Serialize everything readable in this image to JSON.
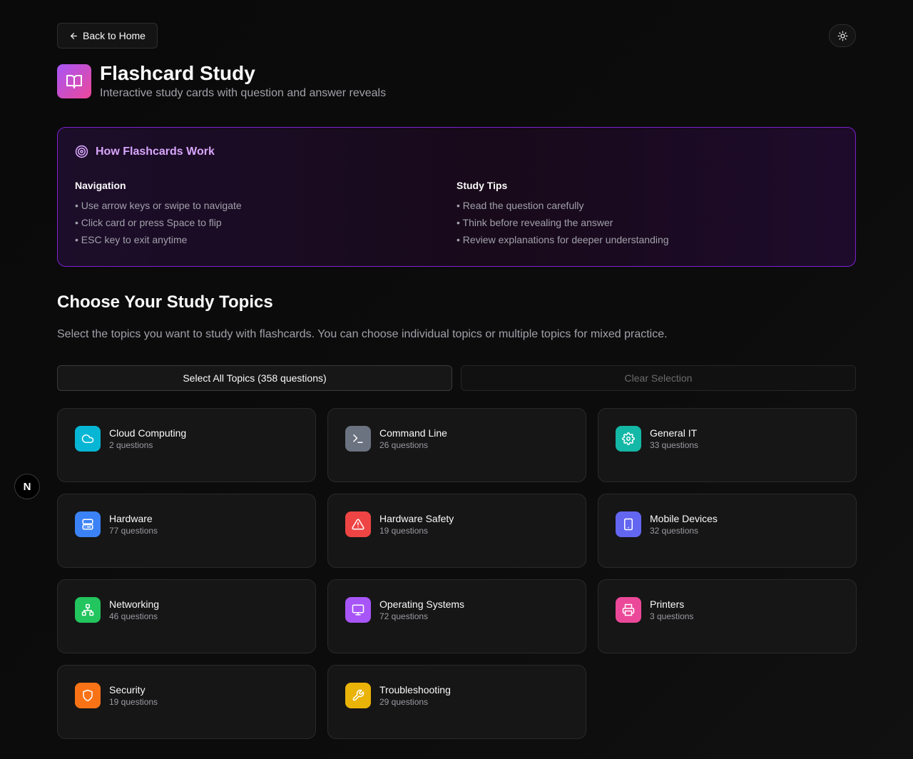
{
  "nav": {
    "back_label": "Back to Home"
  },
  "header": {
    "title": "Flashcard Study",
    "subtitle": "Interactive study cards with question and answer reveals"
  },
  "how": {
    "title": "How Flashcards Work",
    "navigation": {
      "heading": "Navigation",
      "items": [
        "• Use arrow keys or swipe to navigate",
        "• Click card or press Space to flip",
        "• ESC key to exit anytime"
      ]
    },
    "tips": {
      "heading": "Study Tips",
      "items": [
        "• Read the question carefully",
        "• Think before revealing the answer",
        "• Review explanations for deeper understanding"
      ]
    }
  },
  "choose": {
    "title": "Choose Your Study Topics",
    "description": "Select the topics you want to study with flashcards. You can choose individual topics or multiple topics for mixed practice."
  },
  "actions": {
    "select_all": "Select All Topics (358 questions)",
    "clear": "Clear Selection"
  },
  "topics": [
    {
      "name": "Cloud Computing",
      "count": "2 questions",
      "icon": "cloud-icon",
      "color": "#06b6d4"
    },
    {
      "name": "Command Line",
      "count": "26 questions",
      "icon": "terminal-icon",
      "color": "#6b7280"
    },
    {
      "name": "General IT",
      "count": "33 questions",
      "icon": "gear-icon",
      "color": "#14b8a6"
    },
    {
      "name": "Hardware",
      "count": "77 questions",
      "icon": "server-icon",
      "color": "#3b82f6"
    },
    {
      "name": "Hardware Safety",
      "count": "19 questions",
      "icon": "warning-icon",
      "color": "#ef4444"
    },
    {
      "name": "Mobile Devices",
      "count": "32 questions",
      "icon": "tablet-icon",
      "color": "#6366f1"
    },
    {
      "name": "Networking",
      "count": "46 questions",
      "icon": "network-icon",
      "color": "#22c55e"
    },
    {
      "name": "Operating Systems",
      "count": "72 questions",
      "icon": "monitor-icon",
      "color": "#a855f7"
    },
    {
      "name": "Printers",
      "count": "3 questions",
      "icon": "printer-icon",
      "color": "#ec4899"
    },
    {
      "name": "Security",
      "count": "19 questions",
      "icon": "shield-icon",
      "color": "#f97316"
    },
    {
      "name": "Troubleshooting",
      "count": "29 questions",
      "icon": "wrench-icon",
      "color": "#eab308"
    }
  ],
  "badge": {
    "label": "N"
  }
}
